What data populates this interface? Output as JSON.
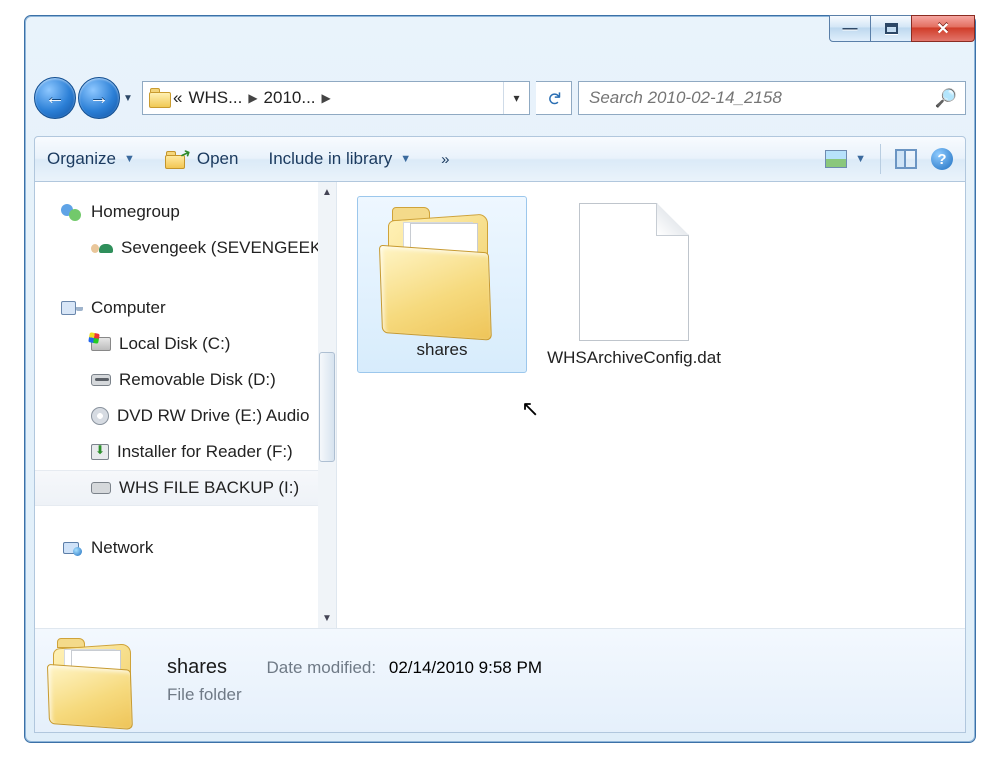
{
  "window": {
    "breadcrumbs": {
      "overflow": "«",
      "seg1": "WHS...",
      "seg2": "2010...",
      "final_arrow": "▶"
    }
  },
  "search": {
    "placeholder": "Search 2010-02-14_2158"
  },
  "toolbar": {
    "organize": "Organize",
    "open": "Open",
    "include": "Include in library",
    "overflow": "»"
  },
  "tree": {
    "homegroup": "Homegroup",
    "user": "Sevengeek (SEVENGEEK)",
    "computer": "Computer",
    "drives": {
      "c": "Local Disk (C:)",
      "d": "Removable Disk (D:)",
      "e": "DVD RW Drive (E:) Audio",
      "f": "Installer for Reader (F:)",
      "i": "WHS FILE BACKUP (I:)"
    },
    "network": "Network"
  },
  "items": {
    "folder": "shares",
    "file": "WHSArchiveConfig.dat"
  },
  "details": {
    "name": "shares",
    "type": "File folder",
    "date_label": "Date modified:",
    "date_value": "02/14/2010 9:58 PM"
  }
}
